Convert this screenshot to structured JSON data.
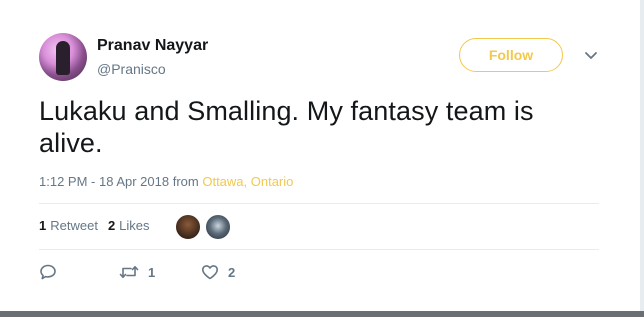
{
  "tweet": {
    "author_name": "Pranav Nayyar",
    "author_handle": "@Pranisco",
    "follow_label": "Follow",
    "text": "Lukaku and Smalling. My fantasy team is alive.",
    "timestamp": "1:12 PM - 18 Apr 2018",
    "from_label": "from",
    "location": "Ottawa, Ontario"
  },
  "stats": {
    "retweets_count": "1",
    "retweets_label": "Retweet",
    "likes_count": "2",
    "likes_label": "Likes"
  },
  "actions": {
    "reply_icon": "reply-icon",
    "retweet_icon": "retweet-icon",
    "retweet_count": "1",
    "like_icon": "heart-icon",
    "like_count": "2"
  },
  "colors": {
    "accent": "#f2c94c",
    "text_primary": "#14171a",
    "text_secondary": "#657786",
    "divider": "#e6ecf0"
  }
}
